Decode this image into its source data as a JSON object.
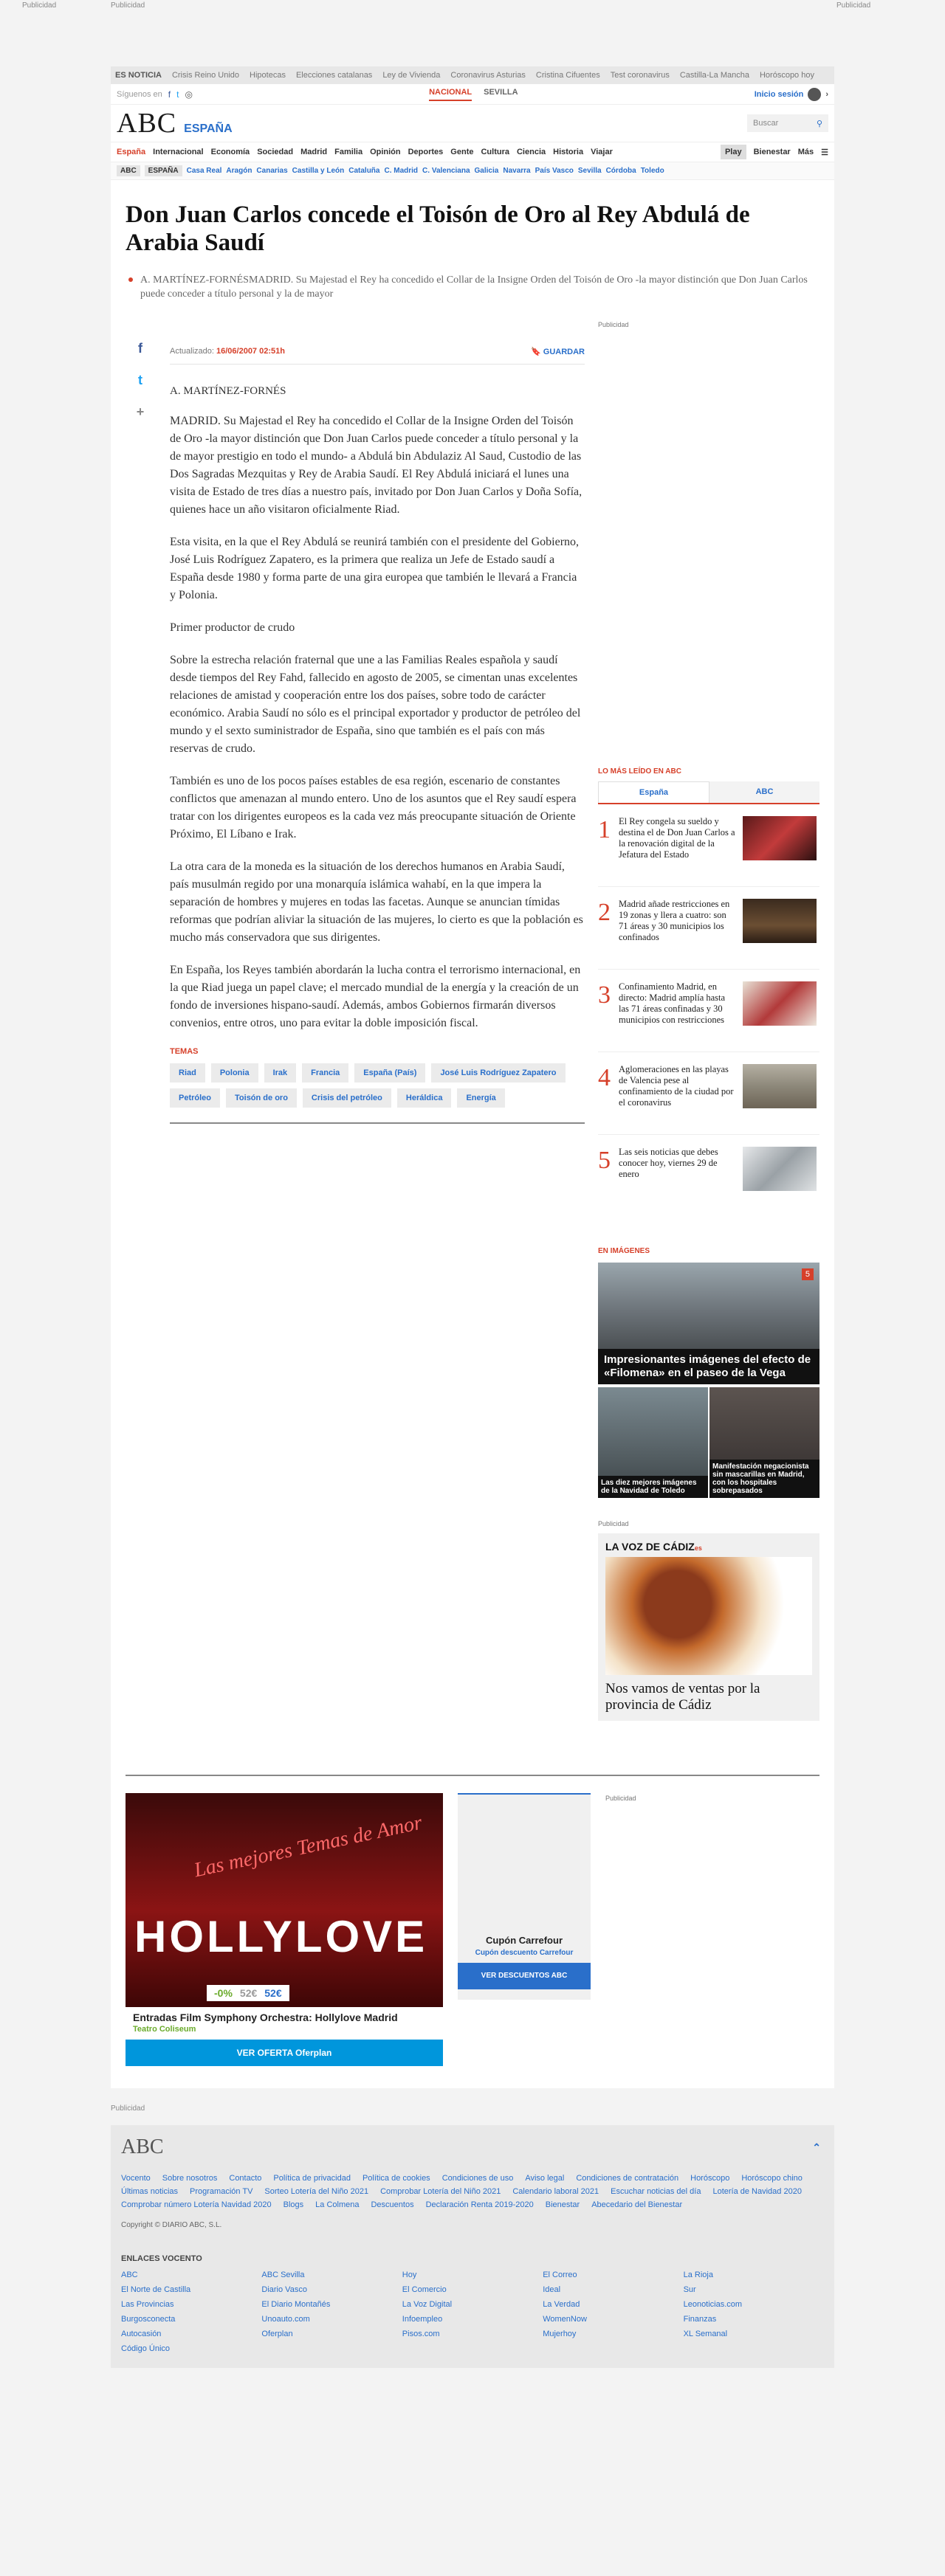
{
  "top_publicidad": [
    "Publicidad",
    "Publicidad",
    "Publicidad"
  ],
  "topbar": {
    "label": "ES NOTICIA",
    "items": [
      "Crisis Reino Unido",
      "Hipotecas",
      "Elecciones catalanas",
      "Ley de Vivienda",
      "Coronavirus Asturias",
      "Cristina Cifuentes",
      "Test coronavirus",
      "Castilla-La Mancha",
      "Horóscopo hoy"
    ]
  },
  "header": {
    "follow": "Síguenos en",
    "edition_on": "NACIONAL",
    "edition_off": "SEVILLA",
    "session": "Inicio sesión",
    "logo": "ABC",
    "section": "ESPAÑA",
    "search_placeholder": "Buscar"
  },
  "nav": {
    "items": [
      "España",
      "Internacional",
      "Economía",
      "Sociedad",
      "Madrid",
      "Familia",
      "Opinión",
      "Deportes",
      "Gente",
      "Cultura",
      "Ciencia",
      "Historia",
      "Viajar"
    ],
    "play": "Play",
    "bienestar": "Bienestar",
    "mas": "Más"
  },
  "subnav": {
    "tags": [
      "ABC",
      "ESPAÑA"
    ],
    "links": [
      "Casa Real",
      "Aragón",
      "Canarias",
      "Castilla y León",
      "Cataluña",
      "C. Madrid",
      "C. Valenciana",
      "Galicia",
      "Navarra",
      "País Vasco",
      "Sevilla",
      "Córdoba",
      "Toledo"
    ]
  },
  "article": {
    "headline": "Don Juan Carlos concede el Toisón de Oro al Rey Abdulá de Arabia Saudí",
    "standfirst": "A. MARTÍNEZ-FORNÉSMADRID. Su Majestad el Rey ha concedido el Collar de la Insigne Orden del Toisón de Oro -la mayor distinción que Don Juan Carlos puede conceder a título personal y la de mayor",
    "updated_label": "Actualizado:",
    "updated": "16/06/2007 02:51h",
    "save": "GUARDAR",
    "author": "A. MARTÍNEZ-FORNÉS",
    "paragraphs": [
      "MADRID. Su Majestad el Rey ha concedido el Collar de la Insigne Orden del Toisón de Oro -la mayor distinción que Don Juan Carlos puede conceder a título personal y la de mayor prestigio en todo el mundo- a Abdulá bin Abdulaziz Al Saud, Custodio de las Dos Sagradas Mezquitas y Rey de Arabia Saudí. El Rey Abdulá iniciará el lunes una visita de Estado de tres días a nuestro país, invitado por Don Juan Carlos y Doña Sofía, quienes hace un año visitaron oficialmente Riad.",
      "Esta visita, en la que el Rey Abdulá se reunirá también con el presidente del Gobierno, José Luis Rodríguez Zapatero, es la primera que realiza un Jefe de Estado saudí a España desde 1980 y forma parte de una gira europea que también le llevará a Francia y Polonia.",
      "Primer productor de crudo",
      "Sobre la estrecha relación fraternal que une a las Familias Reales española y saudí desde tiempos del Rey Fahd, fallecido en agosto de 2005, se cimentan unas excelentes relaciones de amistad y cooperación entre los dos países, sobre todo de carácter económico. Arabia Saudí no sólo es el principal exportador y productor de petróleo del mundo y el sexto suministrador de España, sino que también es el país con más reservas de crudo.",
      "También es uno de los pocos países estables de esa región, escenario de constantes conflictos que amenazan al mundo entero. Uno de los asuntos que el Rey saudí espera tratar con los dirigentes europeos es la cada vez más preocupante situación de Oriente Próximo, El Líbano e Irak.",
      "La otra cara de la moneda es la situación de los derechos humanos en Arabia Saudí, país musulmán regido por una monarquía islámica wahabí, en la que impera la separación de hombres y mujeres en todas las facetas. Aunque se anuncian tímidas reformas que podrían aliviar la situación de las mujeres, lo cierto es que la población es mucho más conservadora que sus dirigentes.",
      "En España, los Reyes también abordarán la lucha contra el terrorismo internacional, en la que Riad juega un papel clave; el mercado mundial de la energía y la creación de un fondo de inversiones hispano-saudí. Además, ambos Gobiernos firmarán diversos convenios, entre otros, uno para evitar la doble imposición fiscal."
    ],
    "temas_title": "TEMAS",
    "tags": [
      "Riad",
      "Polonia",
      "Irak",
      "Francia",
      "España (País)",
      "José Luis Rodríguez Zapatero",
      "Petróleo",
      "Toisón de oro",
      "Crisis del petróleo",
      "Heráldica",
      "Energía"
    ]
  },
  "sidebar": {
    "publicidad": "Publicidad",
    "most_title": "LO MÁS LEÍDO EN ABC",
    "tab_on": "España",
    "tab_off": "ABC",
    "most": [
      {
        "num": "1",
        "text": "El Rey congela su sueldo y destina el de Don Juan Carlos a la renovación digital de la Jefatura del Estado"
      },
      {
        "num": "2",
        "text": "Madrid añade restricciones en 19 zonas y llera a cuatro: son 71 áreas y 30 municipios los confinados"
      },
      {
        "num": "3",
        "text": "Confinamiento Madrid, en directo: Madrid amplía hasta las 71 áreas confinadas y 30 municipios con restricciones"
      },
      {
        "num": "4",
        "text": "Aglomeraciones en las playas de Valencia pese al confinamiento de la ciudad por el coronavirus"
      },
      {
        "num": "5",
        "text": "Las seis noticias que debes conocer hoy, viernes 29 de enero"
      }
    ],
    "img_title": "EN IMÁGENES",
    "gallery_main": "Impresionantes imágenes del efecto de «Filomena» en el paseo de la Vega",
    "gallery_badge": "5",
    "gallery_small": [
      "Las diez mejores imágenes de la Navidad de Toledo",
      "Manifestación negacionista sin mascarillas en Madrid, con los hospitales sobrepasados"
    ],
    "promo_brand": "LA VOZ DE CÁDIZ",
    "promo_brand_suffix": "es",
    "promo_title": "Nos vamos de ventas por la provincia de Cádiz"
  },
  "bottom": {
    "offer_script": "Las mejores Temas de Amor",
    "offer_big": "HOLLYLOVE",
    "discount": "-0%",
    "old_price": "52€",
    "new_price": "52€",
    "offer_title": "Entradas Film Symphony Orchestra: Hollylove Madrid",
    "offer_venue": "Teatro Coliseum",
    "offer_btn": "VER OFERTA Oferplan",
    "coupon_title": "Cupón Carrefour",
    "coupon_sub": "Cupón descuento Carrefour",
    "coupon_btn": "VER DESCUENTOS ABC",
    "publicidad": "Publicidad",
    "publicidad2": "Publicidad"
  },
  "footer": {
    "logo": "ABC",
    "links": [
      "Vocento",
      "Sobre nosotros",
      "Contacto",
      "Política de privacidad",
      "Política de cookies",
      "Condiciones de uso",
      "Aviso legal",
      "Condiciones de contratación",
      "Horóscopo",
      "Horóscopo chino",
      "Últimas noticias",
      "Programación TV",
      "Sorteo Lotería del Niño 2021",
      "Comprobar Lotería del Niño 2021",
      "Calendario laboral 2021",
      "Escuchar noticias del día",
      "Lotería de Navidad 2020",
      "Comprobar número Lotería Navidad 2020",
      "Blogs",
      "La Colmena",
      "Descuentos",
      "Declaración Renta 2019-2020",
      "Bienestar",
      "Abecedario del Bienestar"
    ],
    "copyright": "Copyright © DIARIO ABC, S.L.",
    "enlaces_title": "ENLACES VOCENTO",
    "enlaces": [
      "ABC",
      "ABC Sevilla",
      "Hoy",
      "El Correo",
      "La Rioja",
      "El Norte de Castilla",
      "Diario Vasco",
      "El Comercio",
      "Ideal",
      "Sur",
      "Las Provincias",
      "El Diario Montañés",
      "La Voz Digital",
      "La Verdad",
      "Leonoticias.com",
      "Burgosconecta",
      "Unoauto.com",
      "Infoempleo",
      "WomenNow",
      "Finanzas",
      "Autocasión",
      "Oferplan",
      "Pisos.com",
      "Mujerhoy",
      "XL Semanal",
      "Código Único"
    ]
  }
}
